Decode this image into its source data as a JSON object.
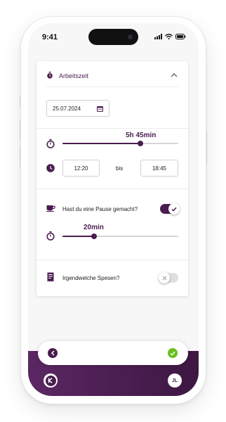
{
  "status_bar": {
    "time": "9:41"
  },
  "card": {
    "title": "Arbeitszeit",
    "date": "25.07.2024",
    "duration": {
      "label": "5h 45min",
      "slider_fraction": 0.67
    },
    "time_range": {
      "start": "12:20",
      "separator": "bis",
      "end": "18:45"
    },
    "pause": {
      "question": "Hast du eine Pause gemacht?",
      "enabled": true,
      "duration_label": "20min",
      "slider_fraction": 0.27
    },
    "expenses": {
      "question": "Irgendwelche Spesen?",
      "enabled": false
    }
  },
  "bottom": {
    "avatar_initials": "JL"
  },
  "colors": {
    "brand": "#4a1d4f",
    "success": "#6abf1e",
    "toggle_off": "#e0e0e0"
  },
  "icons": [
    "stopwatch-icon",
    "chevron-up-icon",
    "calendar-icon",
    "clock-icon",
    "coffee-cup-icon",
    "receipt-icon",
    "back-arrow-icon",
    "check-icon",
    "close-icon",
    "app-logo-icon"
  ]
}
